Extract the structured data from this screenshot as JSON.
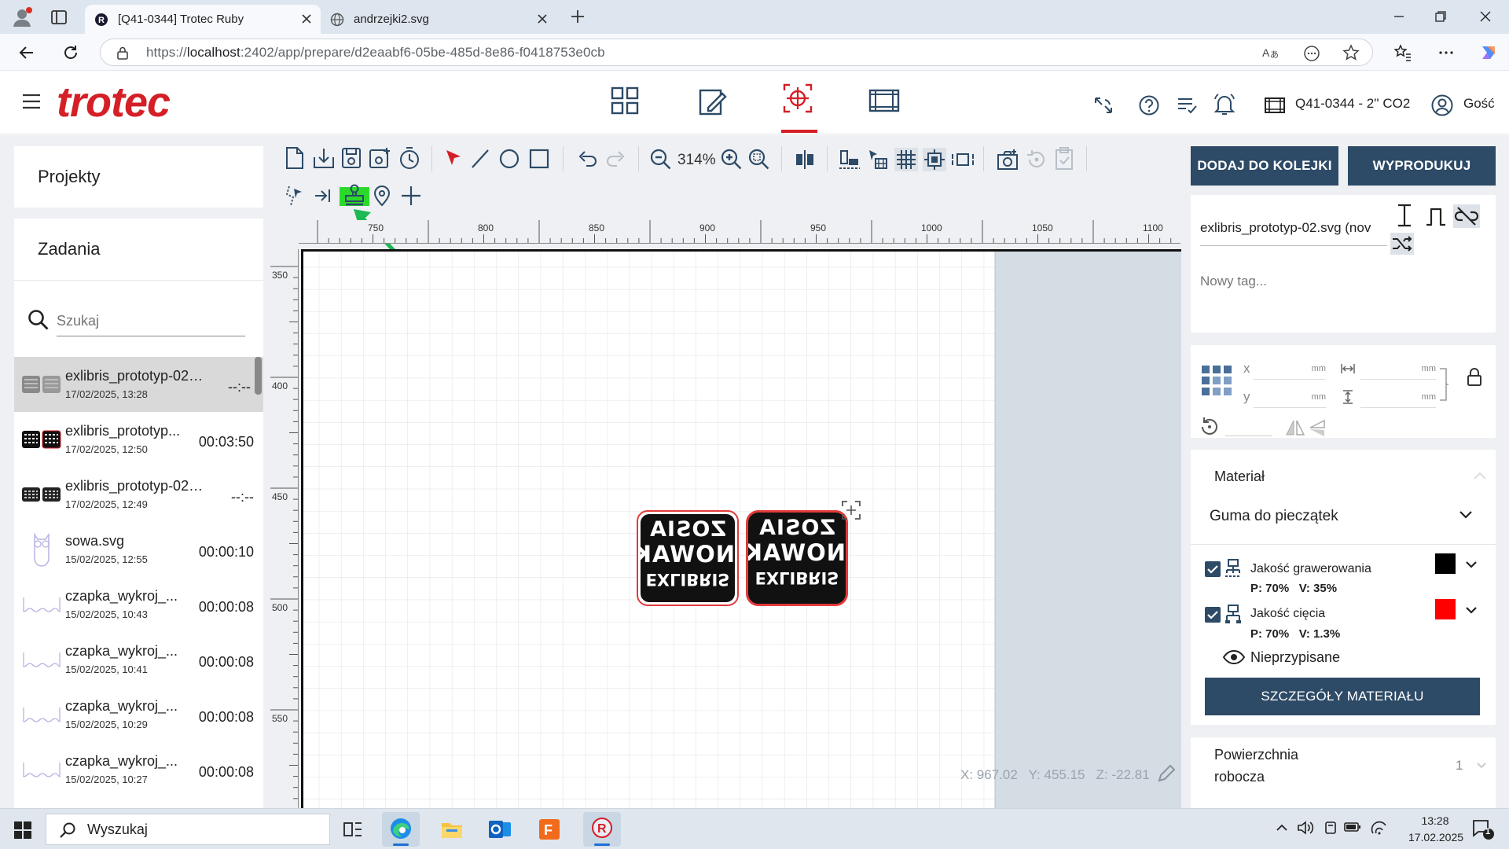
{
  "browser": {
    "tabs": [
      {
        "title": "[Q41-0344] Trotec Ruby",
        "active": true
      },
      {
        "title": "andrzejki2.svg",
        "active": false
      }
    ],
    "url_prefix": "https://",
    "url_host": "localhost",
    "url_rest": ":2402/app/prepare/d2eaabf6-05be-485d-8e86-f0418753e0cb"
  },
  "app": {
    "logo": "trotec",
    "machine": "Q41-0344 - 2'' CO2",
    "user": "Gość",
    "accent": "#d51f26",
    "primary": "#2d4a66"
  },
  "left": {
    "projects_label": "Projekty",
    "jobs_label": "Zadania",
    "search_placeholder": "Szukaj",
    "jobs": [
      {
        "name": "exlibris_prototyp-02.s...",
        "date": "17/02/2025, 13:28",
        "time": "--:--",
        "selected": true
      },
      {
        "name": "exlibris_prototyp...",
        "date": "17/02/2025, 12:50",
        "time": "00:03:50"
      },
      {
        "name": "exlibris_prototyp-02.svg",
        "date": "17/02/2025, 12:49",
        "time": "--:--"
      },
      {
        "name": "sowa.svg",
        "date": "15/02/2025, 12:55",
        "time": "00:00:10"
      },
      {
        "name": "czapka_wykroj_...",
        "date": "15/02/2025, 10:43",
        "time": "00:00:08"
      },
      {
        "name": "czapka_wykroj_...",
        "date": "15/02/2025, 10:41",
        "time": "00:00:08"
      },
      {
        "name": "czapka_wykroj_...",
        "date": "15/02/2025, 10:29",
        "time": "00:00:08"
      },
      {
        "name": "czapka_wykroj_...",
        "date": "15/02/2025, 10:27",
        "time": "00:00:08"
      }
    ]
  },
  "toolbar": {
    "zoom": "314%"
  },
  "canvas": {
    "ruler_x": [
      "750",
      "800",
      "850",
      "900",
      "950",
      "1000",
      "1050",
      "1100"
    ],
    "ruler_y": [
      "350",
      "400",
      "450",
      "500",
      "550"
    ],
    "stamp_text": [
      "ZOSIA",
      "NOWAK",
      "EXLIBRIS"
    ],
    "coords": "X: 967.02   Y: 455.15   Z: -22.81"
  },
  "right": {
    "queue_button": "DODAJ DO KOLEJKI",
    "produce_button": "WYPRODUKUJ",
    "job_name": "exlibris_prototyp-02.svg (nov",
    "tag_placeholder": "Nowy tag...",
    "x_label": "x",
    "y_label": "y",
    "unit": "mm",
    "material_header": "Materiał",
    "material_value": "Guma do pieczątek",
    "engrave_label": "Jakość grawerowania",
    "engrave_params": "P: 70%   V: 35%",
    "engrave_color": "#000000",
    "cut_label": "Jakość cięcia",
    "cut_params": "P: 70%   V: 1.3%",
    "cut_color": "#ff0000",
    "unassigned": "Nieprzypisane",
    "details_button": "SZCZEGÓŁY MATERIAŁU",
    "surface_label_1": "Powierzchnia",
    "surface_label_2": "robocza",
    "surface_value": "1"
  },
  "taskbar": {
    "search": "Wyszukaj",
    "time": "13:28",
    "date": "17.02.2025",
    "notif": "1"
  }
}
